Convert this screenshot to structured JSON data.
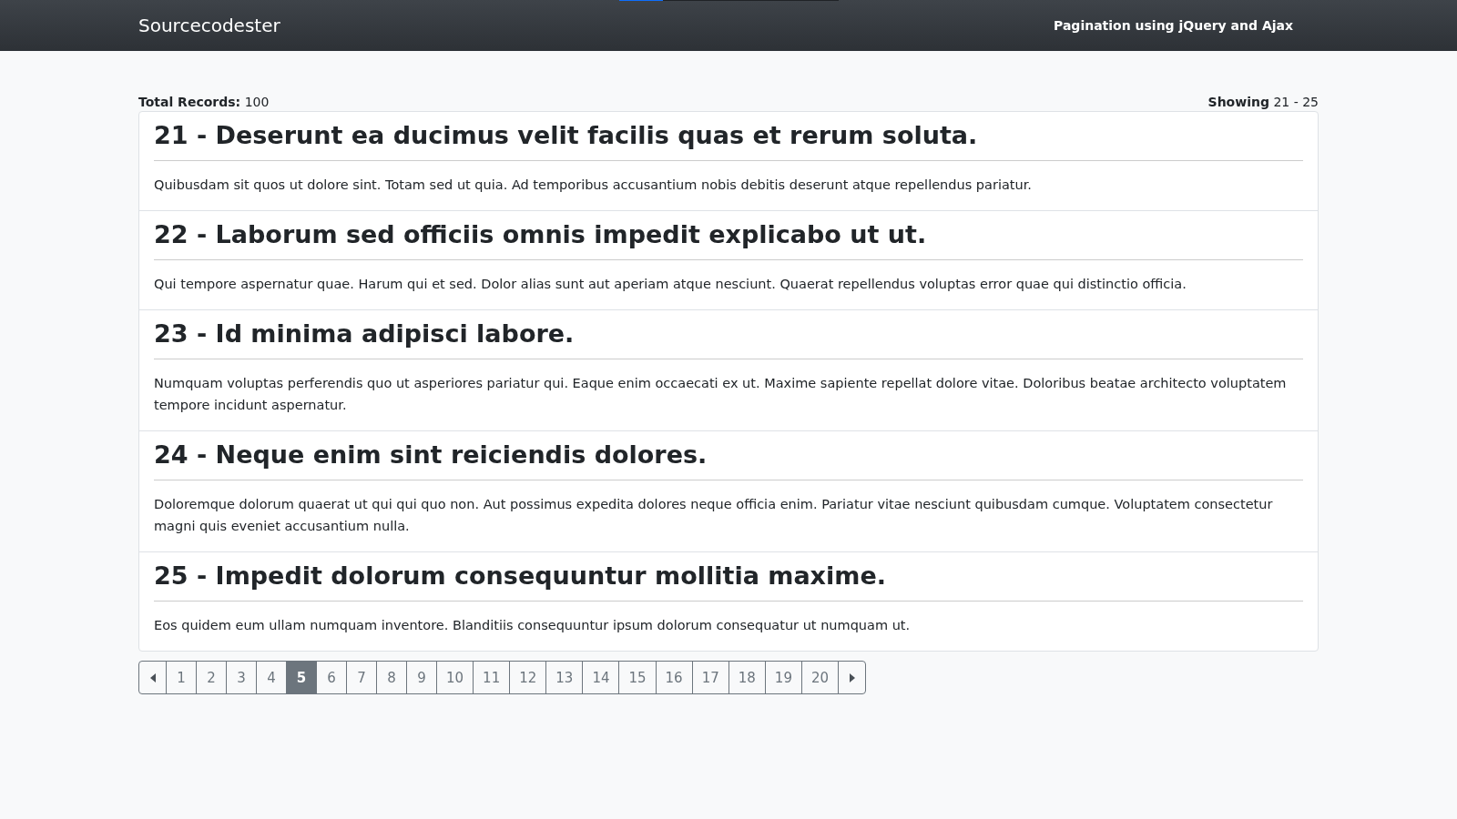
{
  "navbar": {
    "brand": "Sourcecodester",
    "title": "Pagination using jQuery and Ajax",
    "loader": {
      "level": 0.2
    }
  },
  "summary": {
    "total_label": "Total Records:",
    "total_value": "100",
    "showing_label": "Showing",
    "showing_value": "21 - 25"
  },
  "posts": [
    {
      "title": "21 - Deserunt ea ducimus velit facilis quas et rerum soluta.",
      "body": "Quibusdam sit quos ut dolore sint. Totam sed ut quia. Ad temporibus accusantium nobis debitis deserunt atque repellendus pariatur."
    },
    {
      "title": "22 - Laborum sed officiis omnis impedit explicabo ut ut.",
      "body": "Qui tempore aspernatur quae. Harum qui et sed. Dolor alias sunt aut aperiam atque nesciunt. Quaerat repellendus voluptas error quae qui distinctio officia."
    },
    {
      "title": "23 - Id minima adipisci labore.",
      "body": "Numquam voluptas perferendis quo ut asperiores pariatur qui. Eaque enim occaecati ex ut. Maxime sapiente repellat dolore vitae. Doloribus beatae architecto voluptatem tempore incidunt aspernatur."
    },
    {
      "title": "24 - Neque enim sint reiciendis dolores.",
      "body": "Doloremque dolorum quaerat ut qui qui quo non. Aut possimus expedita dolores neque officia enim. Pariatur vitae nesciunt quibusdam cumque. Voluptatem consectetur magni quis eveniet accusantium nulla."
    },
    {
      "title": "25 - Impedit dolorum consequuntur mollitia maxime.",
      "body": "Eos quidem eum ullam numquam inventore. Blanditiis consequuntur ipsum dolorum consequatur ut numquam ut."
    }
  ],
  "pagination": [
    {
      "kind": "prev",
      "selected": false
    },
    {
      "kind": "page",
      "label": "1",
      "selected": false
    },
    {
      "kind": "page",
      "label": "2",
      "selected": false
    },
    {
      "kind": "page",
      "label": "3",
      "selected": false
    },
    {
      "kind": "page",
      "label": "4",
      "selected": false
    },
    {
      "kind": "page",
      "label": "5",
      "selected": true
    },
    {
      "kind": "page",
      "label": "6",
      "selected": false
    },
    {
      "kind": "page",
      "label": "7",
      "selected": false
    },
    {
      "kind": "page",
      "label": "8",
      "selected": false
    },
    {
      "kind": "page",
      "label": "9",
      "selected": false
    },
    {
      "kind": "page",
      "label": "10",
      "selected": false
    },
    {
      "kind": "page",
      "label": "11",
      "selected": false
    },
    {
      "kind": "page",
      "label": "12",
      "selected": false
    },
    {
      "kind": "page",
      "label": "13",
      "selected": false
    },
    {
      "kind": "page",
      "label": "14",
      "selected": false
    },
    {
      "kind": "page",
      "label": "15",
      "selected": false
    },
    {
      "kind": "page",
      "label": "16",
      "selected": false
    },
    {
      "kind": "page",
      "label": "17",
      "selected": false
    },
    {
      "kind": "page",
      "label": "18",
      "selected": false
    },
    {
      "kind": "page",
      "label": "19",
      "selected": false
    },
    {
      "kind": "page",
      "label": "20",
      "selected": false
    },
    {
      "kind": "next",
      "selected": false
    }
  ]
}
